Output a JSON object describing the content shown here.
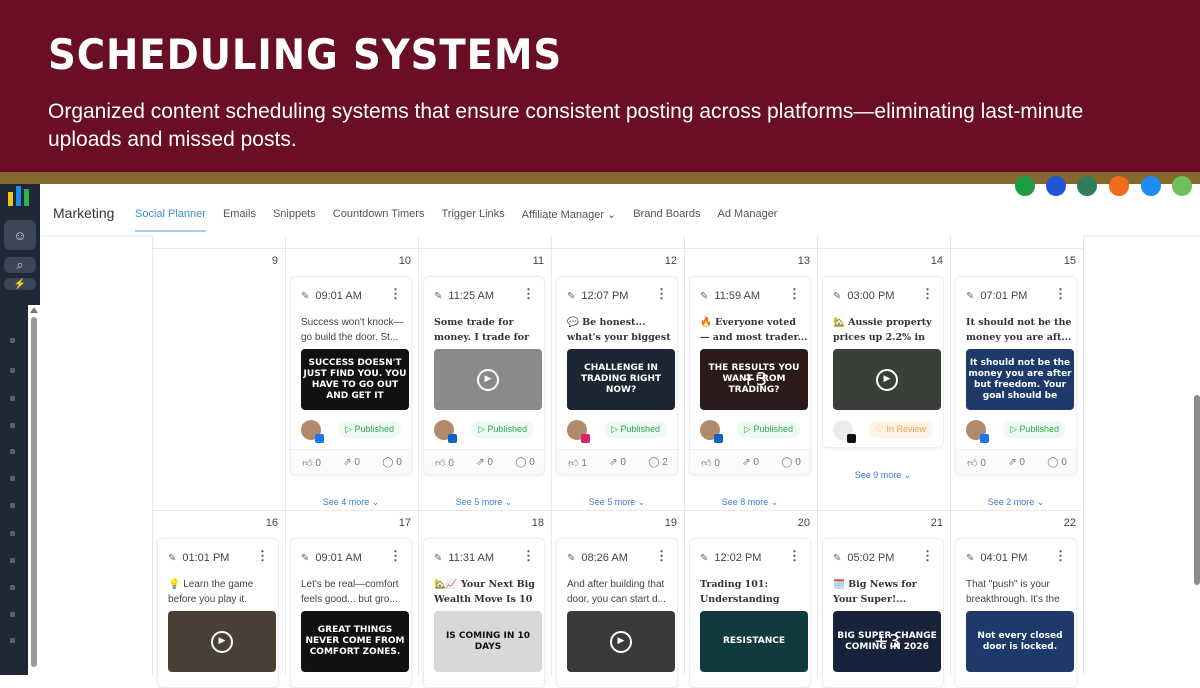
{
  "hero": {
    "title": "SCHEDULING SYSTEMS",
    "subtitle": "Organized content scheduling systems that ensure consistent posting across platforms—eliminating last-minute uploads and missed posts."
  },
  "app": {
    "section": "Marketing",
    "tabs": [
      {
        "label": "Social Planner",
        "active": true
      },
      {
        "label": "Emails"
      },
      {
        "label": "Snippets"
      },
      {
        "label": "Countdown Timers"
      },
      {
        "label": "Trigger Links"
      },
      {
        "label": "Affiliate Manager ⌄"
      },
      {
        "label": "Brand Boards"
      },
      {
        "label": "Ad Manager"
      }
    ]
  },
  "colors": {
    "hero": "#6a0e25",
    "gold": "#86672c",
    "accent": "#3d8fd1",
    "published": "#2fa84f",
    "review": "#f0a046"
  },
  "weeks": [
    {
      "days": [
        {
          "num": "9",
          "card": null
        },
        {
          "num": "10",
          "card": {
            "time": "09:01 AM",
            "text": "Success won't knock—go build the door. St...",
            "serif": false,
            "img": "SUCCESS DOESN'T JUST FIND YOU. YOU HAVE TO GO OUT AND GET IT",
            "imgbg": "#111",
            "video": false,
            "plus": "",
            "status": "Published",
            "network": "facebook",
            "likes": "0",
            "shares": "0",
            "comments": "0",
            "more": "See 4 more ⌄"
          }
        },
        {
          "num": "11",
          "card": {
            "time": "11:25 AM",
            "text": "Some trade for money. I trade for fre...",
            "serif": true,
            "img": "",
            "imgbg": "#8a8a8a",
            "video": true,
            "plus": "",
            "status": "Published",
            "network": "linkedin",
            "likes": "0",
            "shares": "0",
            "comments": "0",
            "more": "See 5 more ⌄"
          }
        },
        {
          "num": "12",
          "card": {
            "time": "12:07 PM",
            "text": "💬 Be honest... what's your biggest cha...",
            "serif": true,
            "img": "CHALLENGE IN TRADING RIGHT NOW?",
            "imgbg": "#1b2533",
            "video": false,
            "plus": "",
            "status": "Published",
            "network": "instagram",
            "likes": "1",
            "shares": "0",
            "comments": "2",
            "more": "See 5 more ⌄"
          }
        },
        {
          "num": "13",
          "card": {
            "time": "11:59 AM",
            "text": "🔥 Everyone voted — and most trader...",
            "serif": true,
            "img": "THE RESULTS YOU WANT FROM TRADING?",
            "imgbg": "#2a1a1a",
            "video": false,
            "plus": "+3",
            "status": "Published",
            "network": "linkedin",
            "likes": "0",
            "shares": "0",
            "comments": "0",
            "more": "See 8 more ⌄"
          }
        },
        {
          "num": "14",
          "card": {
            "time": "03:00 PM",
            "text": "🏡 Aussie property prices up 2.2% in j...",
            "serif": true,
            "img": "",
            "imgbg": "#3b3f3a",
            "video": true,
            "plus": "",
            "status": "In Review",
            "network": "tiktok",
            "likes": "",
            "shares": "",
            "comments": "",
            "more": "See 9 more ⌄"
          }
        },
        {
          "num": "15",
          "card": {
            "time": "07:01 PM",
            "text": "It should not be the money you are aft...",
            "serif": true,
            "img": "It should not be the money you are after but freedom. Your goal should be",
            "imgbg": "#1d3a6b",
            "video": false,
            "plus": "",
            "status": "Published",
            "network": "facebook",
            "likes": "0",
            "shares": "0",
            "comments": "0",
            "more": "See 2 more ⌄"
          }
        }
      ]
    },
    {
      "days": [
        {
          "num": "16",
          "card": {
            "time": "01:01 PM",
            "text": "💡 Learn the game before you play it. Conn...",
            "serif": false,
            "img": "",
            "imgbg": "#4a3f35",
            "video": true,
            "plus": ""
          }
        },
        {
          "num": "17",
          "card": {
            "time": "09:01 AM",
            "text": "Let's be real—comfort feels good... but gro...",
            "serif": false,
            "img": "GREAT THINGS NEVER COME FROM COMFORT ZONES.",
            "imgbg": "#111",
            "video": false,
            "plus": ""
          }
        },
        {
          "num": "18",
          "card": {
            "time": "11:31 AM",
            "text": "🏡📈 Your Next Big Wealth Move Is 10 ...",
            "serif": true,
            "img": "IS COMING IN 10 DAYS",
            "imgbg": "#d8d8d8",
            "video": false,
            "plus": ""
          }
        },
        {
          "num": "19",
          "card": {
            "time": "08:26 AM",
            "text": "And after building that door, you can start d...",
            "serif": false,
            "img": "",
            "imgbg": "#3a3a3a",
            "video": true,
            "plus": ""
          }
        },
        {
          "num": "20",
          "card": {
            "time": "12:02 PM",
            "text": "Trading 101: Understanding Support ...",
            "serif": true,
            "img": "RESISTANCE",
            "imgbg": "#0f3b3e",
            "video": false,
            "plus": ""
          }
        },
        {
          "num": "21",
          "card": {
            "time": "05:02 PM",
            "text": "🗓️ Big News for Your Super!...",
            "serif": true,
            "img": "BIG SUPER CHANGE COMING IN 2026",
            "imgbg": "#17233a",
            "video": false,
            "plus": "+3"
          }
        },
        {
          "num": "22",
          "card": {
            "time": "04:01 PM",
            "text": "That \"push\" is your breakthrough. It's the m...",
            "serif": false,
            "img": "Not every closed door is locked.",
            "imgbg": "#1d3a6b",
            "video": false,
            "plus": ""
          }
        }
      ]
    }
  ]
}
